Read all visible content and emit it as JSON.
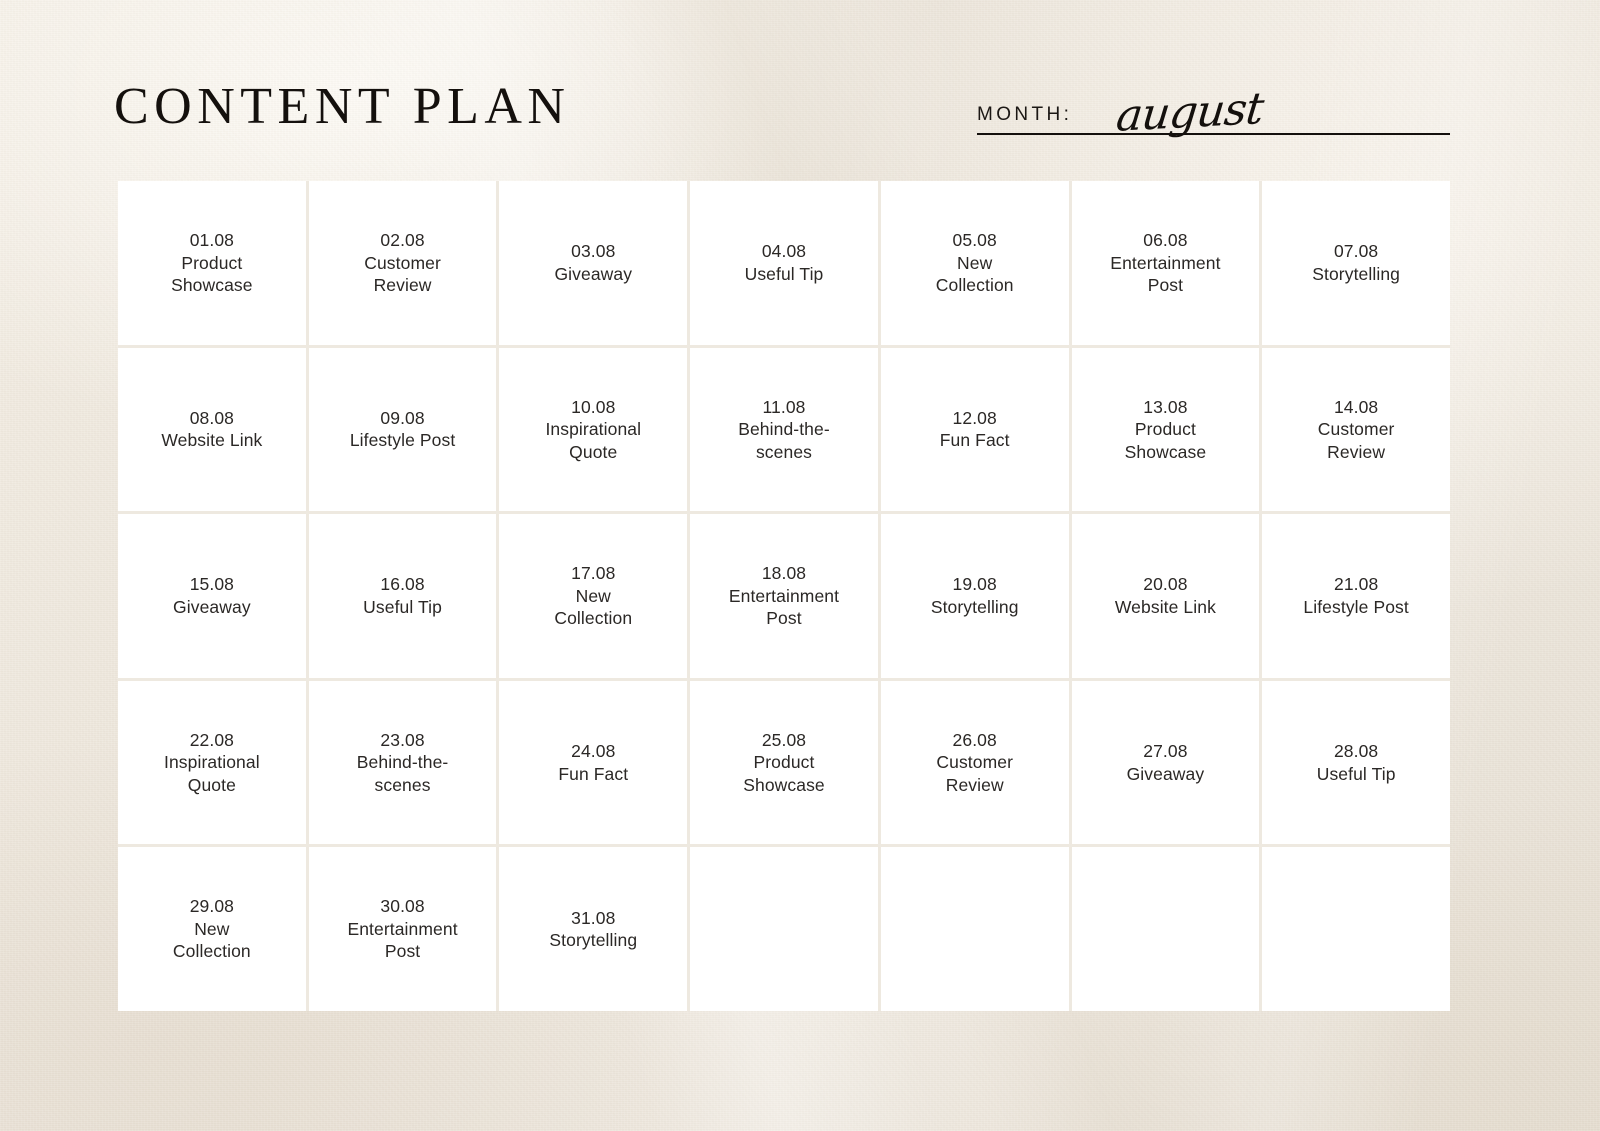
{
  "header": {
    "title": "CONTENT PLAN",
    "month_label": "MONTH:",
    "month_value": "august"
  },
  "colors": {
    "background": "#ebe5db",
    "cell": "#ffffff",
    "text": "#2b2826",
    "ink": "#14100d",
    "grid_gap": "#eee9e0"
  },
  "calendar": {
    "columns": 7,
    "rows": 5,
    "cells": [
      {
        "date": "01.08",
        "topic_line1": "Product",
        "topic_line2": "Showcase"
      },
      {
        "date": "02.08",
        "topic_line1": "Customer",
        "topic_line2": "Review"
      },
      {
        "date": "03.08",
        "topic_line1": "Giveaway",
        "topic_line2": ""
      },
      {
        "date": "04.08",
        "topic_line1": "Useful Tip",
        "topic_line2": ""
      },
      {
        "date": "05.08",
        "topic_line1": "New",
        "topic_line2": "Collection"
      },
      {
        "date": "06.08",
        "topic_line1": "Entertainment",
        "topic_line2": "Post"
      },
      {
        "date": "07.08",
        "topic_line1": "Storytelling",
        "topic_line2": ""
      },
      {
        "date": "08.08",
        "topic_line1": "Website Link",
        "topic_line2": ""
      },
      {
        "date": "09.08",
        "topic_line1": "Lifestyle Post",
        "topic_line2": ""
      },
      {
        "date": "10.08",
        "topic_line1": "Inspirational",
        "topic_line2": "Quote"
      },
      {
        "date": "11.08",
        "topic_line1": "Behind-the-",
        "topic_line2": "scenes"
      },
      {
        "date": "12.08",
        "topic_line1": "Fun Fact",
        "topic_line2": ""
      },
      {
        "date": "13.08",
        "topic_line1": "Product",
        "topic_line2": "Showcase"
      },
      {
        "date": "14.08",
        "topic_line1": "Customer",
        "topic_line2": "Review"
      },
      {
        "date": "15.08",
        "topic_line1": "Giveaway",
        "topic_line2": ""
      },
      {
        "date": "16.08",
        "topic_line1": "Useful Tip",
        "topic_line2": ""
      },
      {
        "date": "17.08",
        "topic_line1": "New",
        "topic_line2": "Collection"
      },
      {
        "date": "18.08",
        "topic_line1": "Entertainment",
        "topic_line2": "Post"
      },
      {
        "date": "19.08",
        "topic_line1": "Storytelling",
        "topic_line2": ""
      },
      {
        "date": "20.08",
        "topic_line1": "Website Link",
        "topic_line2": ""
      },
      {
        "date": "21.08",
        "topic_line1": "Lifestyle Post",
        "topic_line2": ""
      },
      {
        "date": "22.08",
        "topic_line1": "Inspirational",
        "topic_line2": "Quote"
      },
      {
        "date": "23.08",
        "topic_line1": "Behind-the-",
        "topic_line2": "scenes"
      },
      {
        "date": "24.08",
        "topic_line1": "Fun Fact",
        "topic_line2": ""
      },
      {
        "date": "25.08",
        "topic_line1": "Product",
        "topic_line2": "Showcase"
      },
      {
        "date": "26.08",
        "topic_line1": "Customer",
        "topic_line2": "Review"
      },
      {
        "date": "27.08",
        "topic_line1": "Giveaway",
        "topic_line2": ""
      },
      {
        "date": "28.08",
        "topic_line1": "Useful Tip",
        "topic_line2": ""
      },
      {
        "date": "29.08",
        "topic_line1": "New",
        "topic_line2": "Collection"
      },
      {
        "date": "30.08",
        "topic_line1": "Entertainment",
        "topic_line2": "Post"
      },
      {
        "date": "31.08",
        "topic_line1": "Storytelling",
        "topic_line2": ""
      },
      {
        "date": "",
        "topic_line1": "",
        "topic_line2": ""
      },
      {
        "date": "",
        "topic_line1": "",
        "topic_line2": ""
      },
      {
        "date": "",
        "topic_line1": "",
        "topic_line2": ""
      },
      {
        "date": "",
        "topic_line1": "",
        "topic_line2": ""
      }
    ]
  }
}
